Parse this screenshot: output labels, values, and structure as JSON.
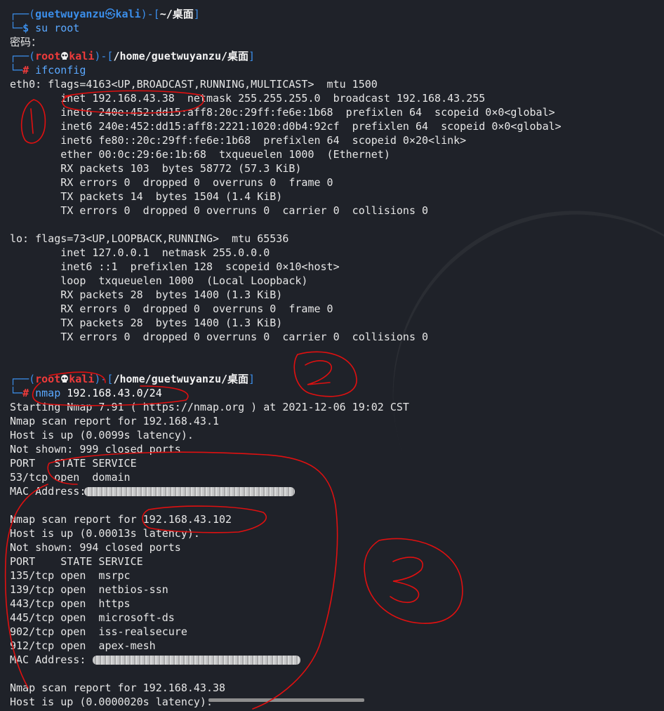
{
  "terminal": {
    "prompt1": {
      "user": "guetwuyanzu",
      "host": "kali",
      "path": "~/桌面",
      "symbol": "$",
      "command": "su root"
    },
    "password_prompt": "密码：",
    "prompt2": {
      "user": "root",
      "host": "kali",
      "path": "/home/guetwuyanzu/桌面",
      "symbol": "#",
      "command": "ifconfig"
    },
    "ifconfig_lines": [
      "eth0: flags=4163<UP,BROADCAST,RUNNING,MULTICAST>  mtu 1500",
      "        inet 192.168.43.38  netmask 255.255.255.0  broadcast 192.168.43.255",
      "        inet6 240e:452:dd15:aff8:20c:29ff:fe6e:1b68  prefixlen 64  scopeid 0×0<global>",
      "        inet6 240e:452:dd15:aff8:2221:1020:d0b4:92cf  prefixlen 64  scopeid 0×0<global>",
      "        inet6 fe80::20c:29ff:fe6e:1b68  prefixlen 64  scopeid 0×20<link>",
      "        ether 00:0c:29:6e:1b:68  txqueuelen 1000  (Ethernet)",
      "        RX packets 103  bytes 58772 (57.3 KiB)",
      "        RX errors 0  dropped 0  overruns 0  frame 0",
      "        TX packets 14  bytes 1504 (1.4 KiB)",
      "        TX errors 0  dropped 0 overruns 0  carrier 0  collisions 0",
      "",
      "lo: flags=73<UP,LOOPBACK,RUNNING>  mtu 65536",
      "        inet 127.0.0.1  netmask 255.0.0.0",
      "        inet6 ::1  prefixlen 128  scopeid 0×10<host>",
      "        loop  txqueuelen 1000  (Local Loopback)",
      "        RX packets 28  bytes 1400 (1.3 KiB)",
      "        RX errors 0  dropped 0  overruns 0  frame 0",
      "        TX packets 28  bytes 1400 (1.3 KiB)",
      "        TX errors 0  dropped 0 overruns 0  carrier 0  collisions 0"
    ],
    "prompt3": {
      "user": "root",
      "host": "kali",
      "path": "/home/guetwuyanzu/桌面",
      "symbol": "#",
      "command": "nmap",
      "args": "192.168.43.0/24"
    },
    "nmap_lines": [
      "Starting Nmap 7.91 ( https://nmap.org ) at 2021-12-06 19:02 CST",
      "Nmap scan report for 192.168.43.1",
      "Host is up (0.0099s latency).",
      "Not shown: 999 closed ports",
      "PORT   STATE SERVICE",
      "53/tcp open  domain",
      "MAC Address:",
      "",
      "Nmap scan report for 192.168.43.102",
      "Host is up (0.00013s latency).",
      "Not shown: 994 closed ports",
      "PORT    STATE SERVICE",
      "135/tcp open  msrpc",
      "139/tcp open  netbios-ssn",
      "443/tcp open  https",
      "445/tcp open  microsoft-ds",
      "902/tcp open  iss-realsecure",
      "912/tcp open  apex-mesh",
      "MAC Address:",
      "",
      "Nmap scan report for 192.168.43.38",
      "Host is up (0.0000020s latency)."
    ],
    "colors": {
      "background": "#1f2229",
      "prompt_frame": "#3b8eea",
      "root_red": "#ef3b3b",
      "annotation_red": "#e01010"
    }
  }
}
